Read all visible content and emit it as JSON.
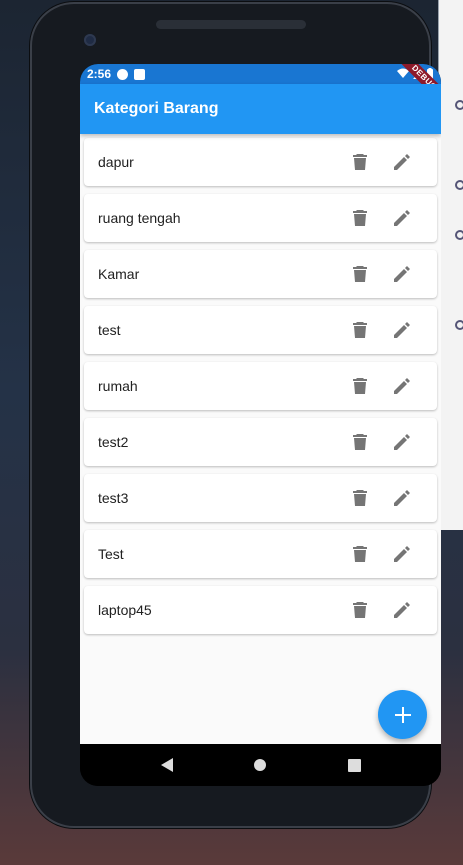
{
  "status_bar": {
    "time": "2:56",
    "debug_label": "DEBUG"
  },
  "app_bar": {
    "title": "Kategori Barang"
  },
  "categories": [
    {
      "name": "dapur"
    },
    {
      "name": "ruang tengah"
    },
    {
      "name": "Kamar"
    },
    {
      "name": "test"
    },
    {
      "name": "rumah"
    },
    {
      "name": "test2"
    },
    {
      "name": "test3"
    },
    {
      "name": "Test"
    },
    {
      "name": "laptop45"
    }
  ],
  "actions": {
    "delete_icon": "delete-icon",
    "edit_icon": "edit-icon"
  },
  "fab": {
    "icon": "plus-icon"
  },
  "colors": {
    "primary": "#2196f3",
    "status_bar": "#1976d2",
    "icon_grey": "#757575"
  }
}
